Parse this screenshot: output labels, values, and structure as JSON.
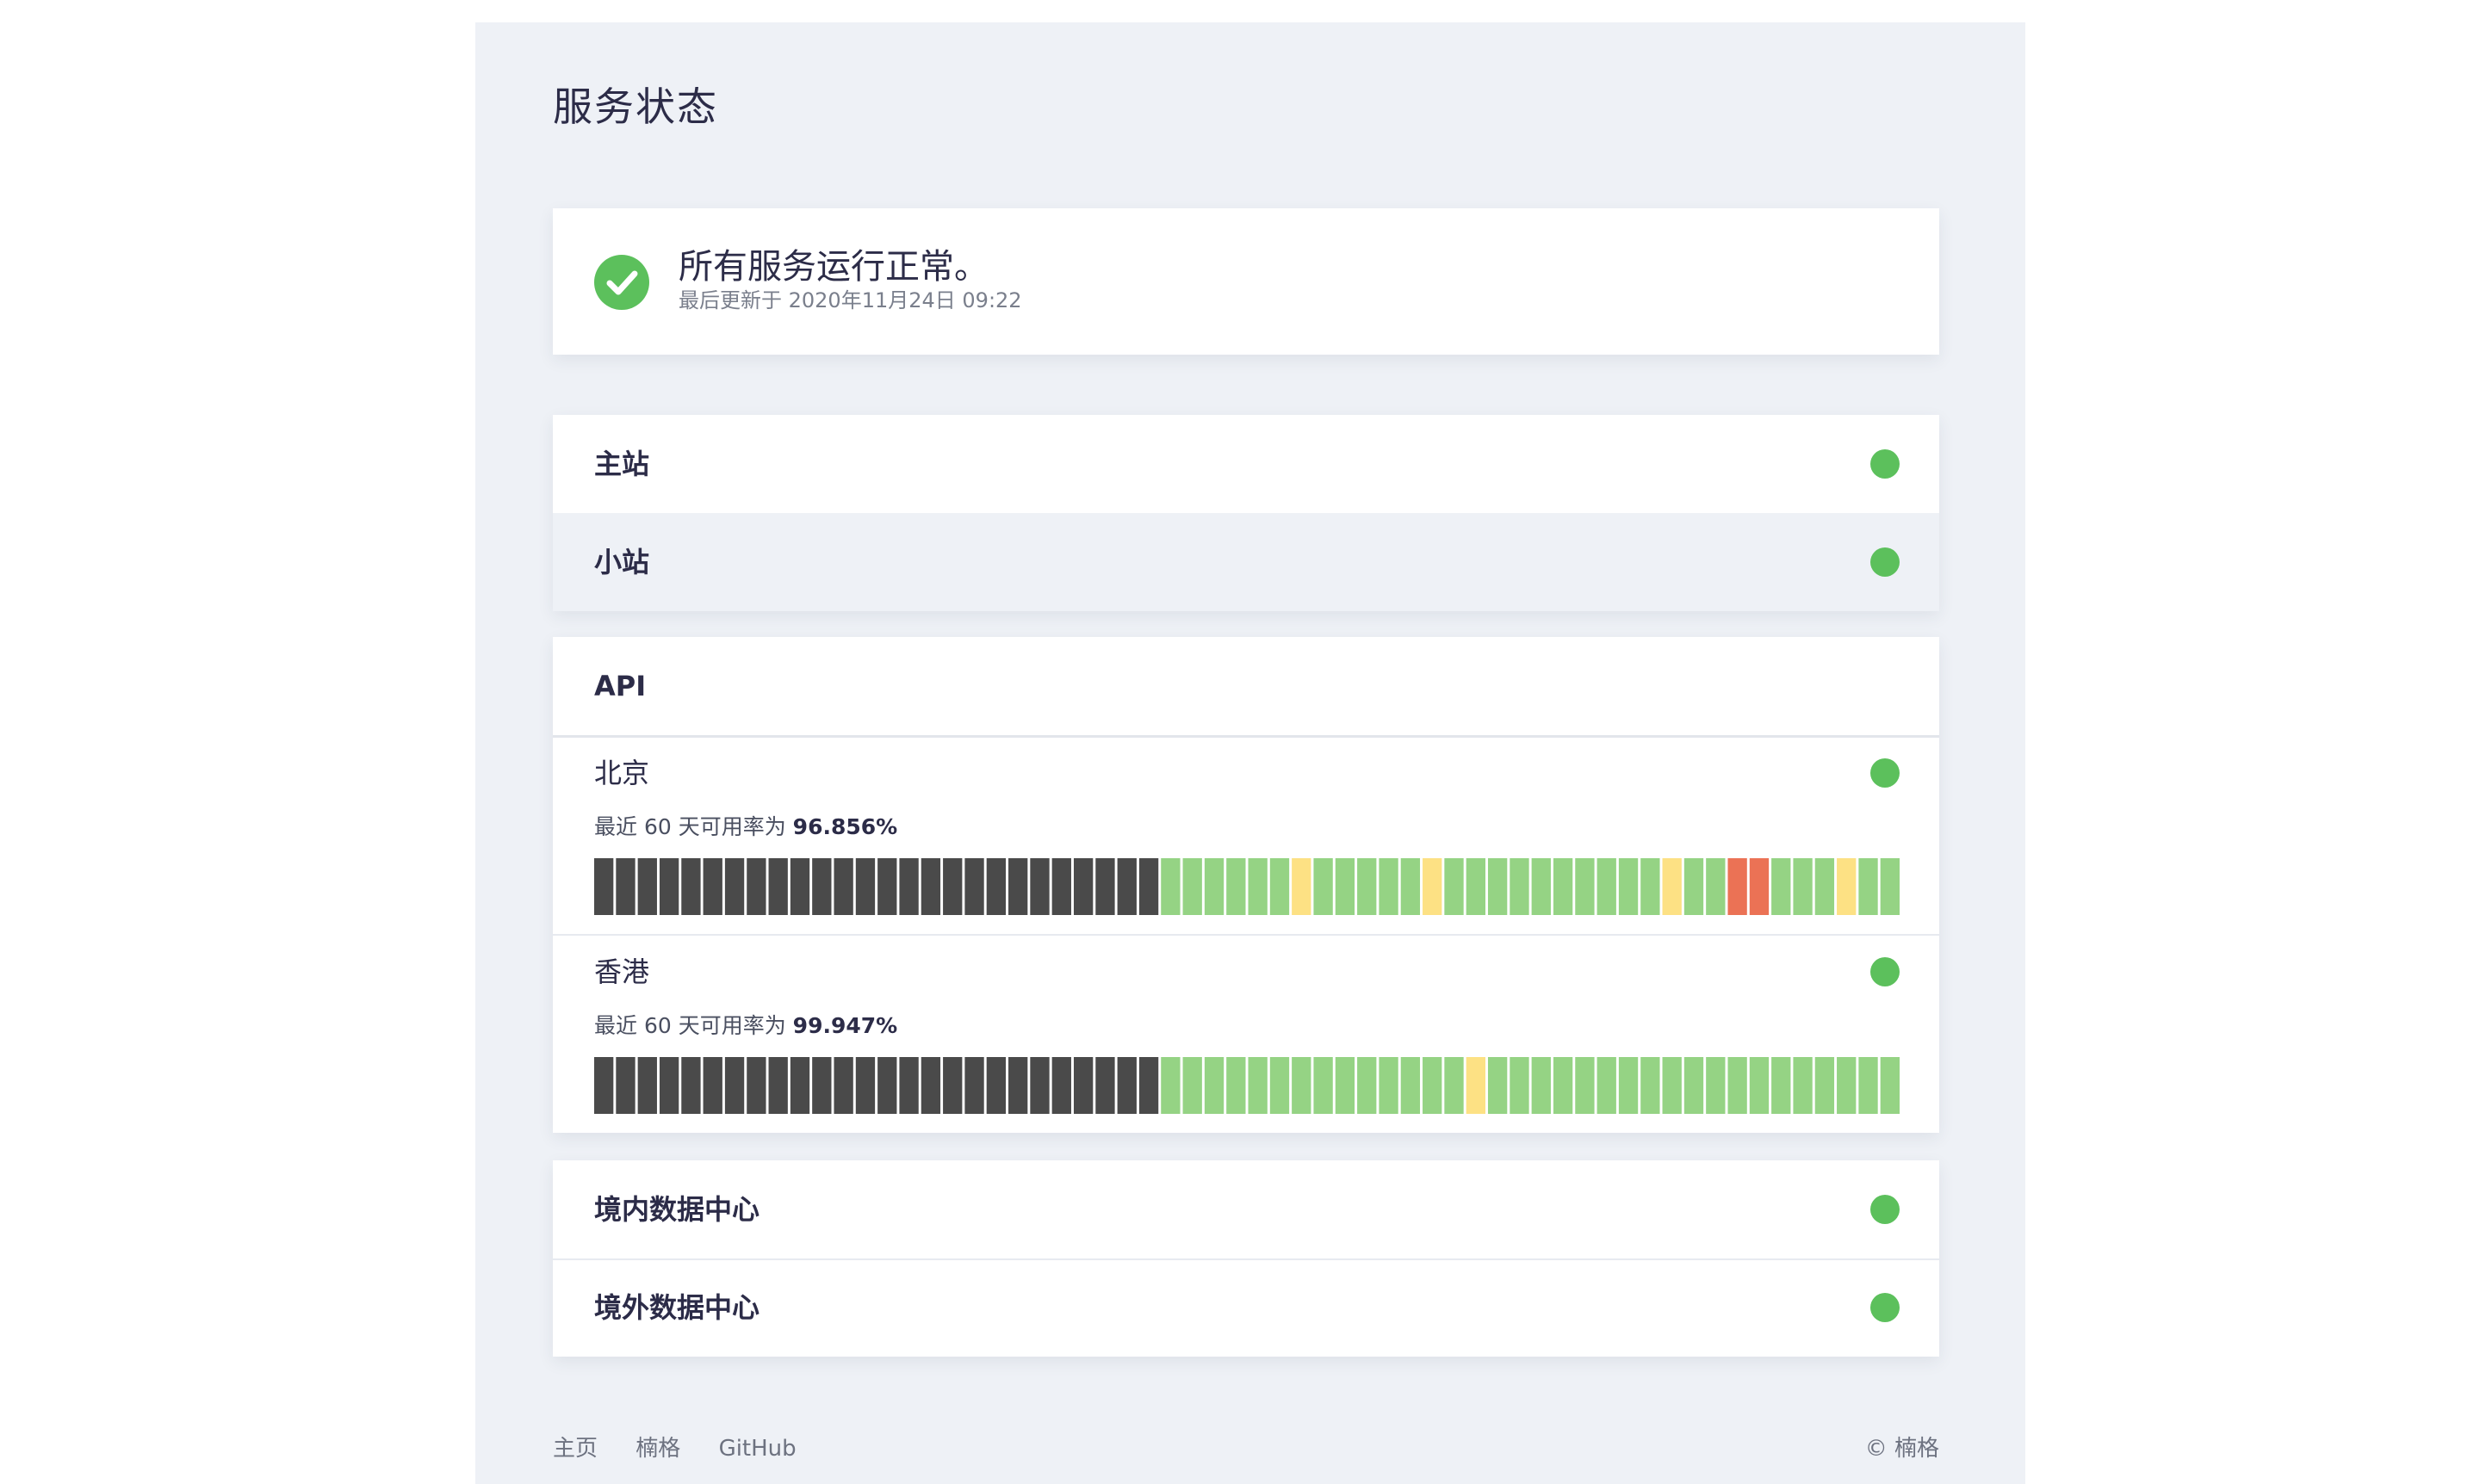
{
  "header": {
    "title": "服务状态"
  },
  "summary": {
    "status": "所有服务运行正常。",
    "updated": "最后更新于 2020年11月24日 09:22",
    "icon": "check-circle-icon",
    "color": "#5cc05c"
  },
  "groups": {
    "sites": [
      {
        "name": "主站",
        "status": "operational"
      },
      {
        "name": "小站",
        "status": "operational"
      }
    ],
    "api": {
      "title": "API",
      "regions": [
        {
          "name": "北京",
          "uptime_prefix": "最近 60 天可用率为",
          "uptime_value": "96.856%",
          "status": "operational",
          "days": [
            "none",
            "none",
            "none",
            "none",
            "none",
            "none",
            "none",
            "none",
            "none",
            "none",
            "none",
            "none",
            "none",
            "none",
            "none",
            "none",
            "none",
            "none",
            "none",
            "none",
            "none",
            "none",
            "none",
            "none",
            "none",
            "none",
            "up",
            "up",
            "up",
            "up",
            "up",
            "up",
            "warn",
            "up",
            "up",
            "up",
            "up",
            "up",
            "warn",
            "up",
            "up",
            "up",
            "up",
            "up",
            "up",
            "up",
            "up",
            "up",
            "up",
            "warn",
            "up",
            "up",
            "down",
            "down",
            "up",
            "up",
            "up",
            "warn",
            "up",
            "up"
          ]
        },
        {
          "name": "香港",
          "uptime_prefix": "最近 60 天可用率为",
          "uptime_value": "99.947%",
          "status": "operational",
          "days": [
            "none",
            "none",
            "none",
            "none",
            "none",
            "none",
            "none",
            "none",
            "none",
            "none",
            "none",
            "none",
            "none",
            "none",
            "none",
            "none",
            "none",
            "none",
            "none",
            "none",
            "none",
            "none",
            "none",
            "none",
            "none",
            "none",
            "up",
            "up",
            "up",
            "up",
            "up",
            "up",
            "up",
            "up",
            "up",
            "up",
            "up",
            "up",
            "up",
            "up",
            "warn",
            "up",
            "up",
            "up",
            "up",
            "up",
            "up",
            "up",
            "up",
            "up",
            "up",
            "up",
            "up",
            "up",
            "up",
            "up",
            "up",
            "up",
            "up",
            "up"
          ]
        }
      ]
    },
    "datacenters": [
      {
        "name": "境内数据中心",
        "status": "operational"
      },
      {
        "name": "境外数据中心",
        "status": "operational"
      }
    ]
  },
  "colors": {
    "operational": "#5cc05c",
    "none": "#4a4a4a",
    "up": "#95d384",
    "warn": "#fde184",
    "down": "#eb7255"
  },
  "footer": {
    "links": [
      "主页",
      "楠格",
      "GitHub"
    ],
    "copyright": "© 楠格"
  }
}
